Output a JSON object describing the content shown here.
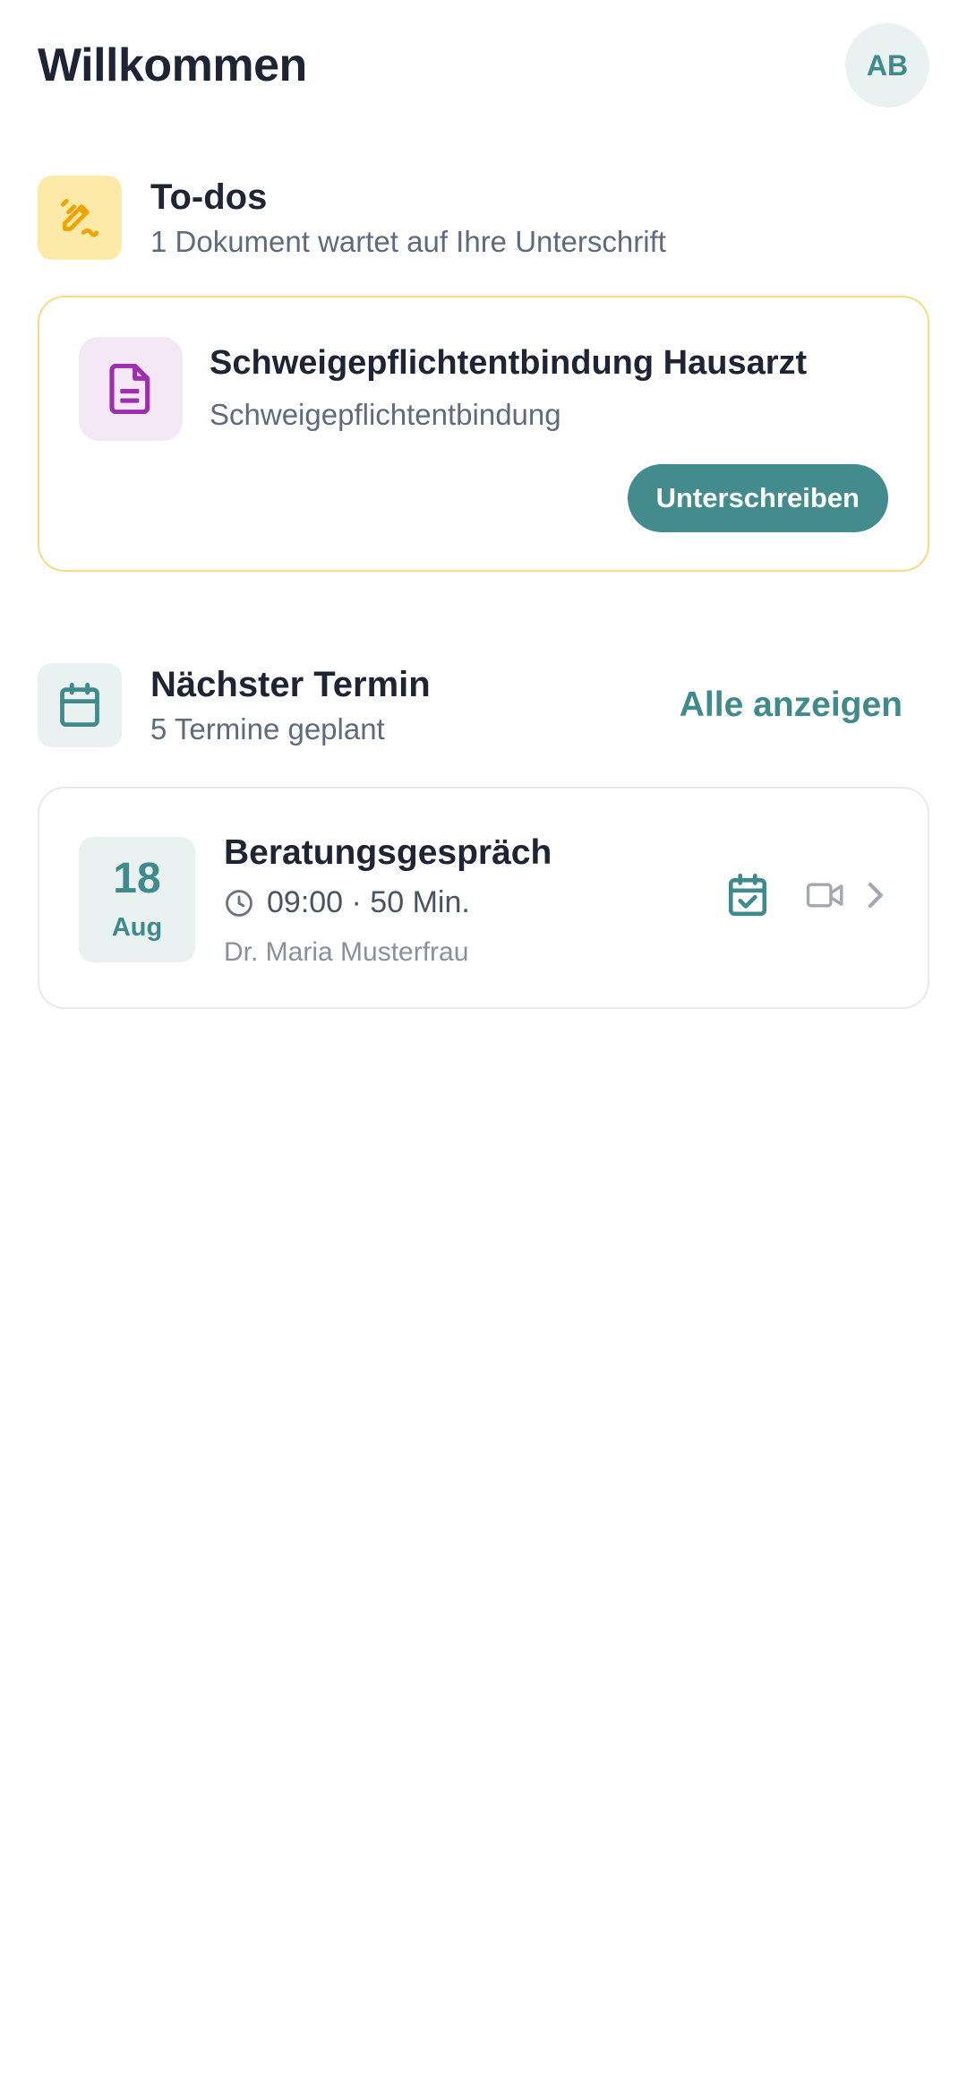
{
  "header": {
    "title": "Willkommen",
    "avatar_initials": "AB"
  },
  "todos": {
    "title": "To-dos",
    "subtitle": "1 Dokument wartet auf Ihre Unterschrift",
    "icon": "signature-icon",
    "card": {
      "icon": "document-icon",
      "title": "Schweigepflichtentbindung Hausarzt",
      "subtitle": "Schweigepflichtentbindung",
      "button_label": "Unterschreiben"
    }
  },
  "appointments": {
    "title": "Nächster Termin",
    "subtitle": "5 Termine geplant",
    "icon": "calendar-icon",
    "show_all_label": "Alle anzeigen",
    "next": {
      "day": "18",
      "month": "Aug",
      "title": "Beratungsgespräch",
      "time": "09:00 · 50 Min.",
      "doctor": "Dr. Maria Musterfrau",
      "icons": [
        "calendar-check-icon",
        "video-camera-icon",
        "chevron-right-icon"
      ]
    }
  },
  "colors": {
    "accent": "#3f8a8c",
    "button": "#438b8d",
    "todo_icon_bg": "#fde9a8",
    "todo_icon": "#f2a100",
    "todo_border": "#f6dc86",
    "doc_icon_bg": "#f5e8f6",
    "doc_icon": "#9b2fae",
    "accent_bg": "#e9f1f1"
  }
}
